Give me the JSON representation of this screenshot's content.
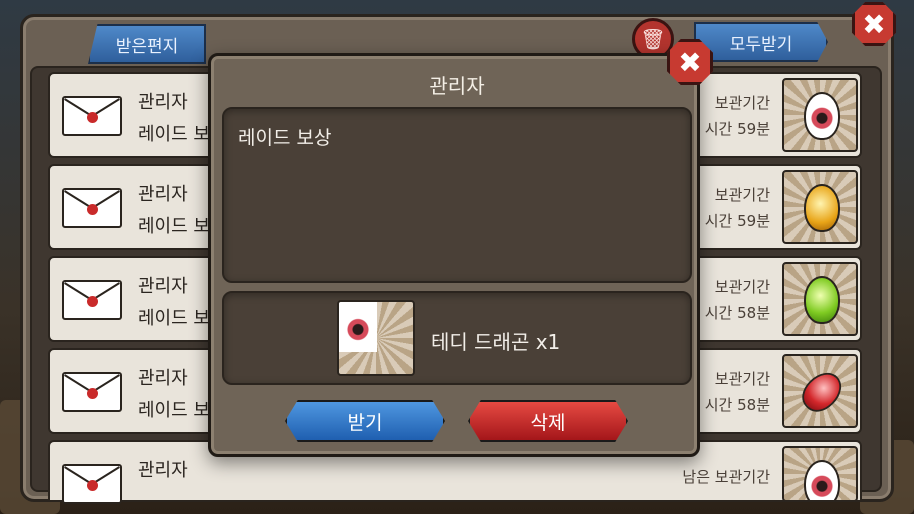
{
  "mailbox": {
    "tab_label": "받은편지",
    "claim_all_label": "모두받기",
    "trash_icon": "trash-icon",
    "close_icon": "close-icon",
    "keep_label": "남은 보관기간",
    "rows": [
      {
        "sender": "관리자",
        "subject": "레이드 보",
        "keep_label": "보관기간",
        "time": "시간 59분",
        "item_icon": "pink-egg-icon"
      },
      {
        "sender": "관리자",
        "subject": "레이드 보",
        "keep_label": "보관기간",
        "time": "시간 59분",
        "item_icon": "gold-crystal-icon"
      },
      {
        "sender": "관리자",
        "subject": "레이드 보",
        "keep_label": "보관기간",
        "time": "시간 58분",
        "item_icon": "green-crystal-icon"
      },
      {
        "sender": "관리자",
        "subject": "레이드 보",
        "keep_label": "보관기간",
        "time": "시간 58분",
        "item_icon": "red-gem-icon"
      },
      {
        "sender": "관리자",
        "subject": "",
        "keep_label": "남은 보관기간",
        "time": "",
        "item_icon": "pink-egg-icon"
      }
    ]
  },
  "dialog": {
    "title": "관리자",
    "message": "레이드 보상",
    "reward_label": "테디 드래곤 x1",
    "reward_icon": "teddy-dragon-egg-icon",
    "receive_label": "받기",
    "delete_label": "삭제",
    "close_icon": "close-icon"
  }
}
